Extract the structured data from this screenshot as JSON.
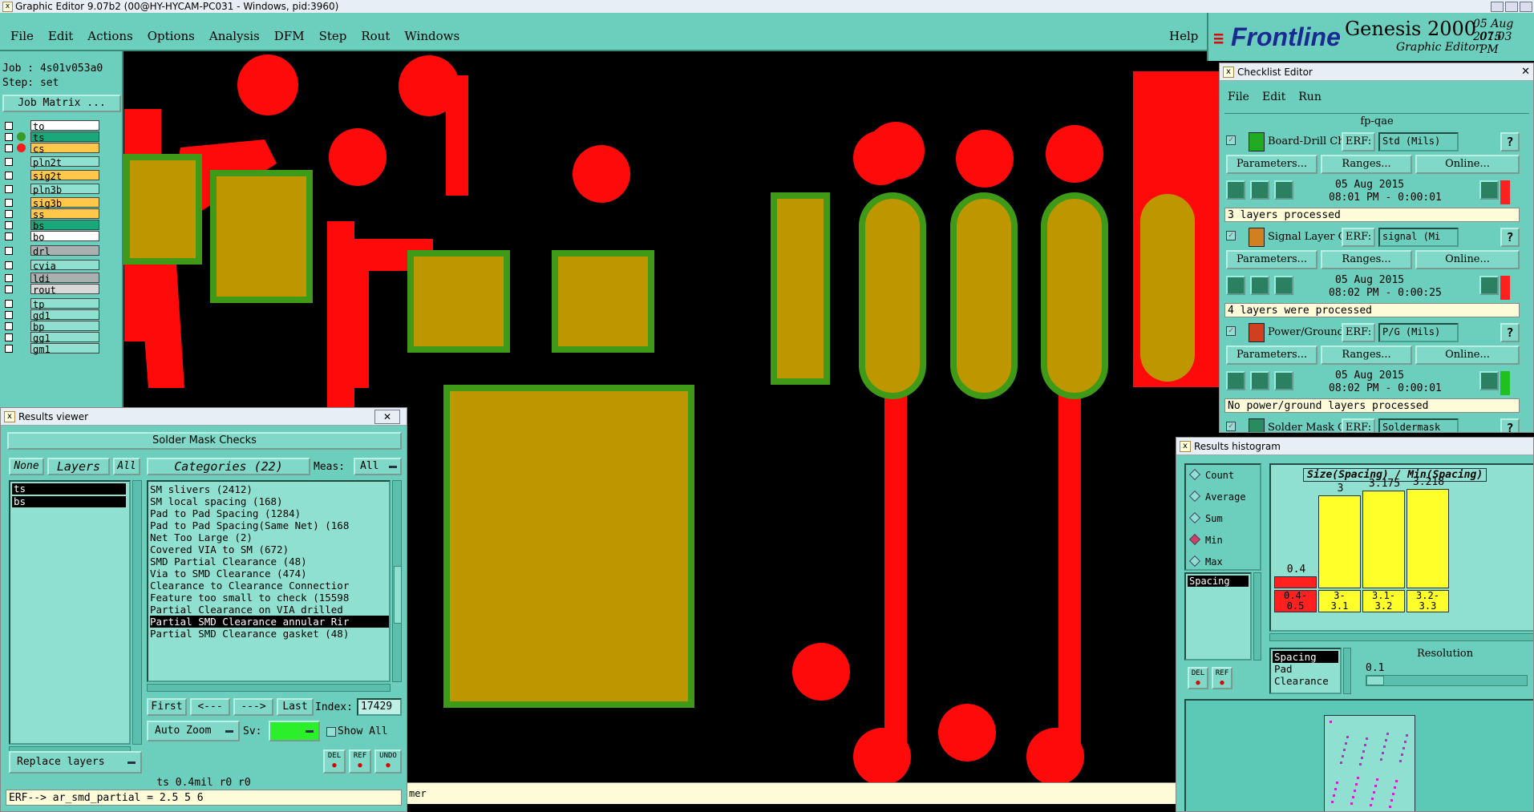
{
  "app": {
    "title": "Graphic Editor 9.07b2 (00@HY-HYCAM-PC031 - Windows, pid:3960)"
  },
  "menu": [
    "File",
    "Edit",
    "Actions",
    "Options",
    "Analysis",
    "DFM",
    "Step",
    "Rout",
    "Windows"
  ],
  "help_label": "Help",
  "brand": {
    "logo": "Frontline",
    "product": "Genesis 2000",
    "subtitle": "Graphic Editor",
    "date": "05 Aug 2015",
    "time": "07:03 PM"
  },
  "job": {
    "job_label": "Job : 4s01v053a0",
    "step_label": "Step: set",
    "matrix_button": "Job Matrix ..."
  },
  "layers": [
    {
      "name": "to",
      "color": "#ffffff",
      "dot": ""
    },
    {
      "name": "ts",
      "color": "#1aa77a",
      "dot": "#3a9a2a"
    },
    {
      "name": "cs",
      "color": "#ffc84a",
      "dot": "#ff1a1a"
    },
    {
      "name": "pln2t",
      "color": "#8fe0d0",
      "dot": ""
    },
    {
      "name": "sig2t",
      "color": "#ffc84a",
      "dot": ""
    },
    {
      "name": "pln3b",
      "color": "#8fe0d0",
      "dot": ""
    },
    {
      "name": "sig3b",
      "color": "#ffc84a",
      "dot": ""
    },
    {
      "name": "ss",
      "color": "#ffc84a",
      "dot": ""
    },
    {
      "name": "bs",
      "color": "#1aa77a",
      "dot": ""
    },
    {
      "name": "bo",
      "color": "#ffffff",
      "dot": ""
    },
    {
      "name": "drl",
      "color": "#a9b0b0",
      "dot": ""
    },
    {
      "name": "cvia",
      "color": "#8fe0d0",
      "dot": ""
    },
    {
      "name": "ldi",
      "color": "#a9b0b0",
      "dot": ""
    },
    {
      "name": "rout",
      "color": "#d8d8d8",
      "dot": ""
    },
    {
      "name": "tp",
      "color": "#8fe0d0",
      "dot": ""
    },
    {
      "name": "gd1",
      "color": "#8fe0d0",
      "dot": ""
    },
    {
      "name": "bp",
      "color": "#8fe0d0",
      "dot": ""
    },
    {
      "name": "gg1",
      "color": "#8fe0d0",
      "dot": ""
    },
    {
      "name": "gm1",
      "color": "#8fe0d0",
      "dot": ""
    }
  ],
  "results_viewer": {
    "title": "Results viewer",
    "header": "Solder Mask Checks",
    "none": "None",
    "layers": "Layers",
    "all": "All",
    "categories": "Categories (22)",
    "meas_label": "Meas:",
    "meas_value": "All",
    "selected_layers": [
      "ts",
      "bs"
    ],
    "items": [
      "SM slivers (2412)",
      "SM local spacing (168)",
      "Pad to Pad Spacing (1284)",
      "Pad to Pad Spacing(Same Net) (168",
      "Net Too Large (2)",
      "Covered VIA to SM (672)",
      "SMD Partial Clearance (48)",
      "Via to SMD Clearance (474)",
      "Clearance to Clearance Connectior",
      "Feature too small to check (15598",
      "Partial Clearance on VIA drilled",
      "Partial SMD Clearance annular Rir",
      "Partial SMD Clearance gasket (48)"
    ],
    "selected_index": 11,
    "nav": {
      "first": "First",
      "prev": "<---",
      "next": "--->",
      "last": "Last",
      "index_label": "Index:",
      "index_value": "17429"
    },
    "auto_zoom": "Auto Zoom",
    "sv_label": "Sv:",
    "show_all": "Show All",
    "replace_layers": "Replace layers",
    "del": "DEL",
    "ref": "REF",
    "undo": "UNDO",
    "status_line": "ts 0.4mil  r0  r0",
    "erf_line": "ERF--> ar_smd_partial = 2.5 5 6"
  },
  "bottom_message": "mer",
  "checklist": {
    "title": "Checklist Editor",
    "menu": [
      "File",
      "Edit",
      "Run"
    ],
    "name": "fp-qae",
    "erf": "ERF:",
    "parameters": "Parameters...",
    "ranges": "Ranges...",
    "online": "Online...",
    "help_q": "?",
    "items": [
      {
        "name": "Board-Drill Che",
        "erf_value": "Std (Mils)",
        "date": "05 Aug 2015",
        "time": "08:01 PM - 0:00:01",
        "status": "3 layers processed",
        "status_color": "#ff2020"
      },
      {
        "name": "Signal Layer Ch",
        "erf_value": "signal (Mi",
        "date": "05 Aug 2015",
        "time": "08:02 PM - 0:00:25",
        "status": "4 layers were processed",
        "status_color": "#ff2020"
      },
      {
        "name": "Power/Ground C",
        "erf_value": "P/G (Mils)",
        "date": "05 Aug 2015",
        "time": "08:02 PM - 0:00:01",
        "status": "No power/ground layers processed",
        "status_color": "#20c020"
      },
      {
        "name": "Solder Mask Che",
        "erf_value": "Soldermask",
        "date": "",
        "time": "",
        "status": "",
        "status_color": "#ff2020"
      }
    ]
  },
  "histogram": {
    "title": "Results histogram",
    "modes": [
      "Count",
      "Average",
      "Sum",
      "Min",
      "Max"
    ],
    "selected_mode": "Min",
    "chart_title": "Size(Spacing) / Min(Spacing)",
    "left_list": [
      "Spacing"
    ],
    "bars": [
      {
        "value": "0.4",
        "range": "0.4-\n0.5",
        "level": 0.124,
        "color": "#ff2020"
      },
      {
        "value": "3",
        "range": "3-\n3.1",
        "level": 0.932,
        "color": "#ffff2a"
      },
      {
        "value": "3.175",
        "range": "3.1-\n3.2",
        "level": 0.986,
        "color": "#ffff2a"
      },
      {
        "value": "3.218",
        "range": "3.2-\n3.3",
        "level": 1.0,
        "color": "#ffff2a"
      }
    ],
    "del": "DEL",
    "ref": "REF",
    "types": [
      "Spacing",
      "Pad",
      "Clearance"
    ],
    "resolution_label": "Resolution",
    "resolution_value": "0.1"
  }
}
